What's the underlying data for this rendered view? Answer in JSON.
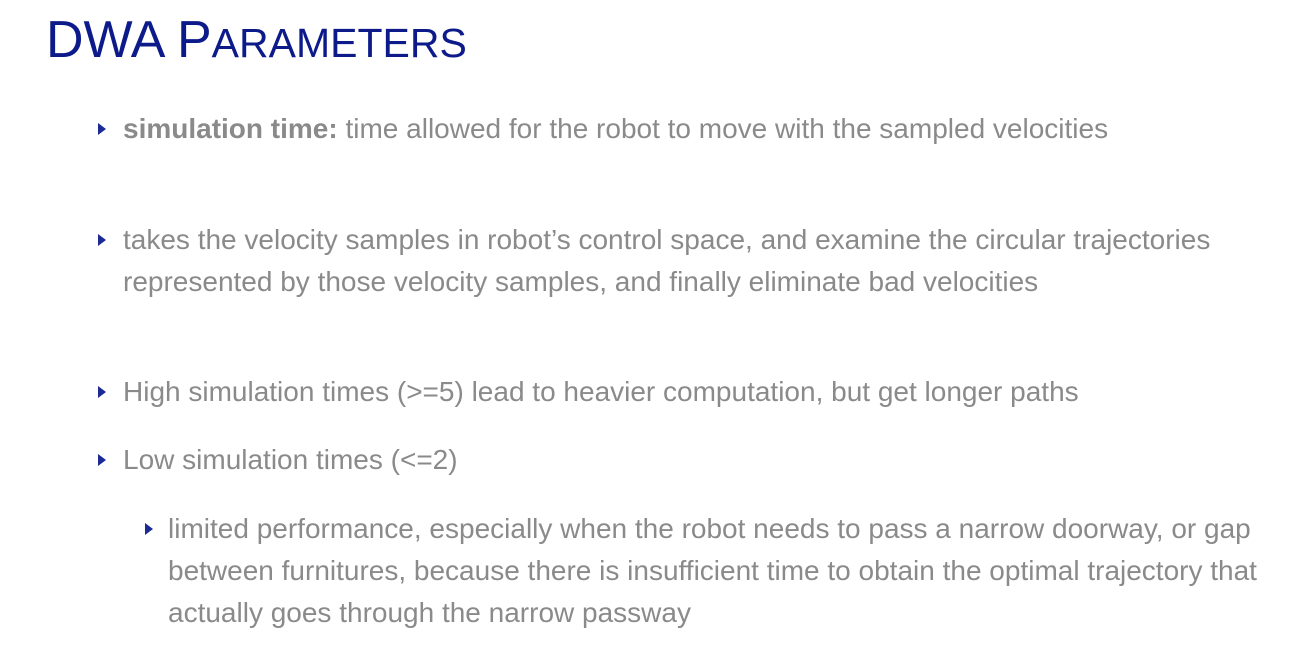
{
  "title": {
    "cap1": "DWA P",
    "small": "ARAMETERS"
  },
  "bullets": [
    {
      "bold": "simulation time:",
      "text": " time allowed for the robot to move with the sampled velocities"
    },
    {
      "text": "takes the velocity samples in robot’s control space, and examine the circular trajectories represented by those velocity samples, and finally eliminate bad velocities"
    },
    {
      "text": "High simulation times (>=5) lead to heavier computation, but get longer paths"
    },
    {
      "text": "Low simulation times (<=2)"
    },
    {
      "text": "limited performance, especially when the robot needs to pass a narrow doorway, or gap between furnitures, because there is insufficient time to obtain the optimal trajectory that actually goes through the narrow passway"
    }
  ],
  "colors": {
    "title": "#0d1b8a",
    "body_text": "#8a8a8a",
    "bullet_marker": "#1c2a96"
  },
  "icons": {
    "bullet_marker": "triangle-right-icon"
  }
}
